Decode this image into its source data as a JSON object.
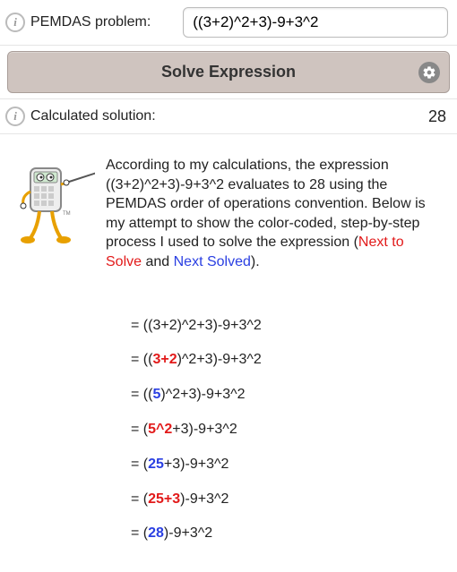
{
  "input": {
    "label": "PEMDAS problem:",
    "value": "((3+2)^2+3)-9+3^2"
  },
  "button": {
    "label": "Solve Expression"
  },
  "result": {
    "label": "Calculated solution:",
    "value": "28"
  },
  "description": {
    "p1a": "According to my calculations, the expression ((3+2)^2+3)-9+3^2 evaluates to 28 using the PEMDAS order of operations convention. Below is my attempt to show the color-coded, step-by-step process I used to solve the expression (",
    "next_to_solve": "Next to Solve",
    "and": " and ",
    "next_solved": "Next Solved",
    "p1b": ")."
  },
  "steps": [
    {
      "pre": "= ((3+2)^2+3)-9+3^2",
      "h": "",
      "cls": "",
      "post": ""
    },
    {
      "pre": "= ((",
      "h": "3+2",
      "cls": "red bold",
      "post": ")^2+3)-9+3^2"
    },
    {
      "pre": "= ((",
      "h": "5",
      "cls": "blue bold",
      "post": ")^2+3)-9+3^2"
    },
    {
      "pre": "= (",
      "h": "5^2",
      "cls": "red bold",
      "post": "+3)-9+3^2"
    },
    {
      "pre": "= (",
      "h": "25",
      "cls": "blue bold",
      "post": "+3)-9+3^2"
    },
    {
      "pre": "= (",
      "h": "25+3",
      "cls": "red bold",
      "post": ")-9+3^2"
    },
    {
      "pre": "= (",
      "h": "28",
      "cls": "blue bold",
      "post": ")-9+3^2"
    }
  ]
}
